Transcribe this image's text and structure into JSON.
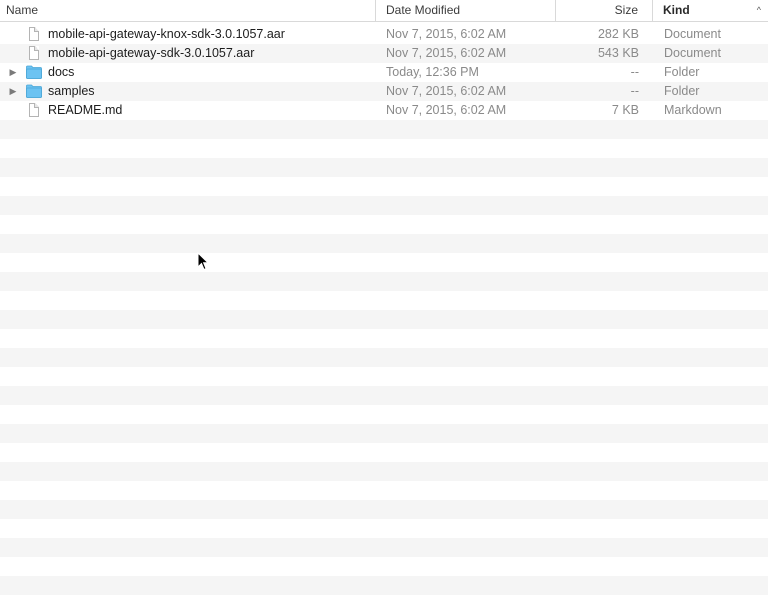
{
  "header": {
    "name_label": "Name",
    "date_label": "Date Modified",
    "size_label": "Size",
    "kind_label": "Kind",
    "sort_indicator": "^"
  },
  "files": [
    {
      "name": "mobile-api-gateway-knox-sdk-3.0.1057.aar",
      "date": "Nov 7, 2015, 6:02 AM",
      "size": "282 KB",
      "kind": "Document",
      "icon": "document-icon",
      "expandable": false
    },
    {
      "name": "mobile-api-gateway-sdk-3.0.1057.aar",
      "date": "Nov 7, 2015, 6:02 AM",
      "size": "543 KB",
      "kind": "Document",
      "icon": "document-icon",
      "expandable": false
    },
    {
      "name": "docs",
      "date": "Today, 12:36 PM",
      "size": "--",
      "kind": "Folder",
      "icon": "folder-icon",
      "expandable": true
    },
    {
      "name": "samples",
      "date": "Nov 7, 2015, 6:02 AM",
      "size": "--",
      "kind": "Folder",
      "icon": "folder-icon",
      "expandable": true
    },
    {
      "name": "README.md",
      "date": "Nov 7, 2015, 6:02 AM",
      "size": "7 KB",
      "kind": "Markdown",
      "icon": "document-icon",
      "expandable": false
    }
  ],
  "colors": {
    "folder": "#6cc3f2",
    "stripe": "#f5f5f5",
    "text_primary": "#1d1d1d",
    "text_secondary": "#8a8a8a"
  }
}
